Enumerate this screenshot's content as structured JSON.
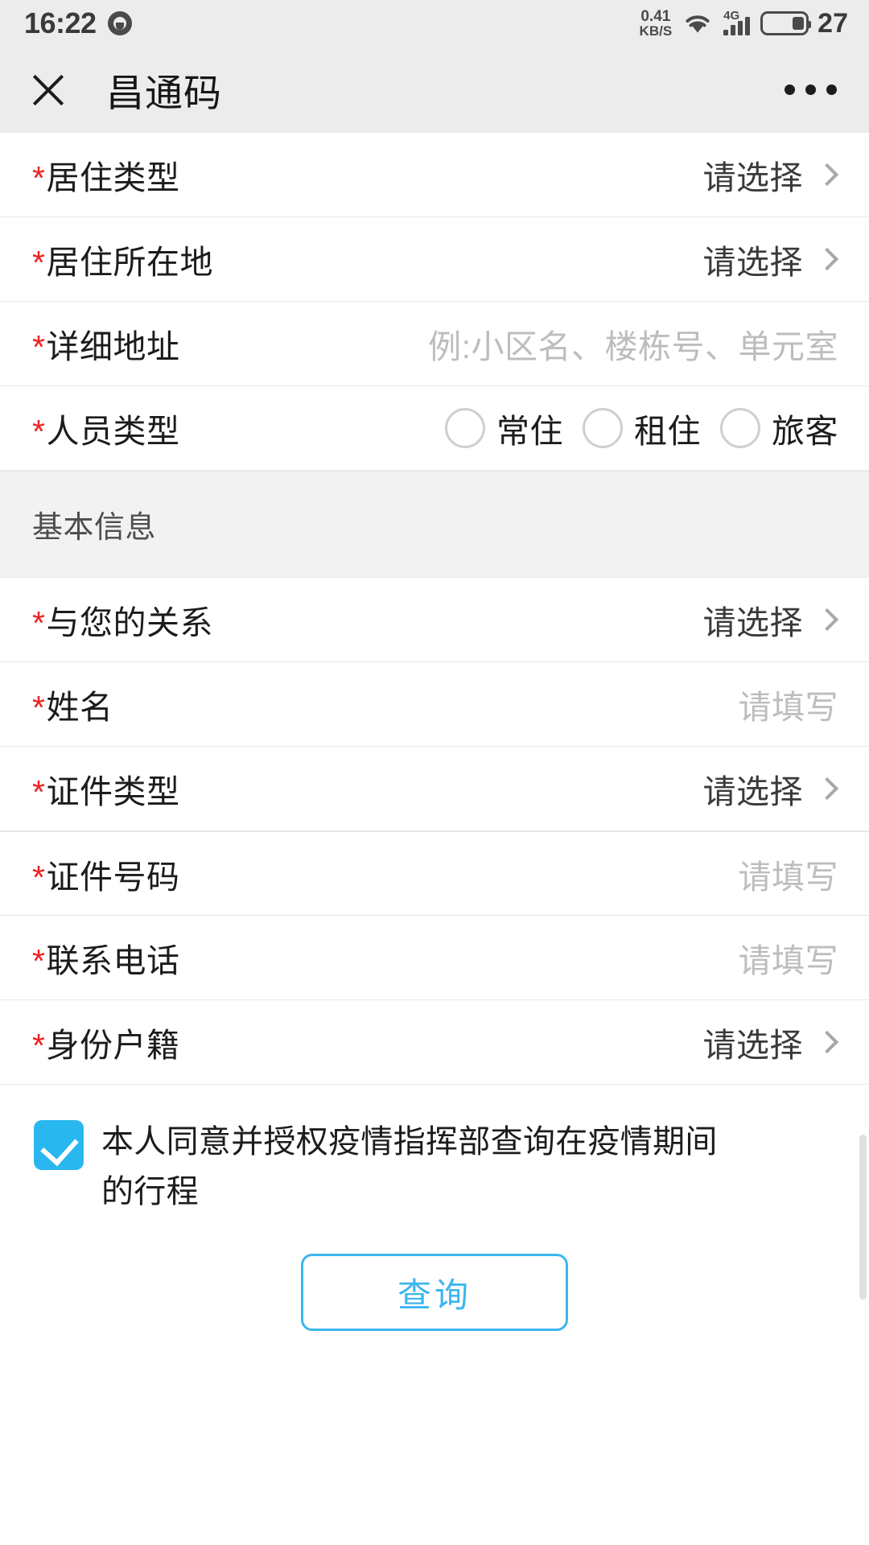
{
  "statusbar": {
    "time": "16:22",
    "app_icon": "clock-app-icon",
    "net_speed_value": "0.41",
    "net_speed_unit": "KB/S",
    "wifi_icon": "wifi-icon",
    "network_type": "4G",
    "signal_icon": "signal-bars-icon",
    "battery_icon": "battery-icon",
    "battery_percent": "27"
  },
  "header": {
    "close_icon": "close-icon",
    "title": "昌通码",
    "more_icon": "more-options-icon"
  },
  "form": {
    "rows": [
      {
        "required": "*",
        "label": "居住类型",
        "value": "请选择",
        "kind": "select"
      },
      {
        "required": "*",
        "label": "居住所在地",
        "value": "请选择",
        "kind": "select"
      },
      {
        "required": "*",
        "label": "详细地址",
        "value": "例:小区名、楼栋号、单元室",
        "kind": "input"
      },
      {
        "required": "*",
        "label": "人员类型",
        "value": "",
        "kind": "radio"
      }
    ],
    "person_type_options": [
      {
        "label": "常住",
        "checked": false
      },
      {
        "label": "租住",
        "checked": false
      },
      {
        "label": "旅客",
        "checked": false
      }
    ],
    "section_title": "基本信息",
    "basic_rows": [
      {
        "required": "*",
        "label": "与您的关系",
        "value": "请选择",
        "kind": "select"
      },
      {
        "required": "*",
        "label": "姓名",
        "value": "请填写",
        "kind": "input"
      },
      {
        "required": "*",
        "label": "证件类型",
        "value": "请选择",
        "kind": "select"
      },
      {
        "required": "*",
        "label": "证件号码",
        "value": "请填写",
        "kind": "input"
      },
      {
        "required": "*",
        "label": "联系电话",
        "value": "请填写",
        "kind": "input"
      },
      {
        "required": "*",
        "label": "身份户籍",
        "value": "请选择",
        "kind": "select"
      }
    ]
  },
  "agreement": {
    "checked": true,
    "text": "本人同意并授权疫情指挥部查询在疫情期间的行程"
  },
  "submit": {
    "label": "查询"
  },
  "colors": {
    "accent": "#3bb6ee",
    "checkbox": "#29b7ef",
    "required_star": "#ee2222",
    "placeholder": "#bdbdbd",
    "bar_bg": "#ececec",
    "section_bg": "#f2f2f2"
  }
}
